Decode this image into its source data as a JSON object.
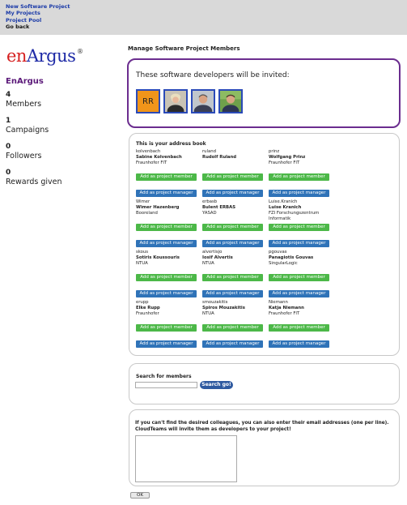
{
  "nav": {
    "new_project": "New Software Project",
    "my_projects": "My Projects",
    "project_pool": "Project Pool",
    "go_back": "Go back"
  },
  "logo": {
    "en": "en",
    "argus": "Argus",
    "reg": "®"
  },
  "sidebar": {
    "app_name": "EnArgus",
    "stats": [
      {
        "num": "4",
        "label": "Members"
      },
      {
        "num": "1",
        "label": "Campaigns"
      },
      {
        "num": "0",
        "label": "Followers"
      },
      {
        "num": "0",
        "label": "Rewards given"
      }
    ]
  },
  "main": {
    "title": "Manage Software Project Members"
  },
  "invite": {
    "text": "These software developers will be invited:",
    "avatars": [
      {
        "type": "initials",
        "text": "RR"
      },
      {
        "type": "photo",
        "icon": "person-photo-woman-icon"
      },
      {
        "type": "photo",
        "icon": "person-photo-man-icon"
      },
      {
        "type": "photo",
        "icon": "person-photo-man-outdoor-icon"
      }
    ]
  },
  "address_book": {
    "title": "This is your address book",
    "add_member_label": "Add as project member",
    "add_manager_label": "Add as project manager",
    "contacts": [
      {
        "user": "kolvenbach",
        "name": "Sabine Kolvenbach",
        "org": "Fraunhofer FIT"
      },
      {
        "user": "ruland",
        "name": "Rudolf Ruland",
        "org": ""
      },
      {
        "user": "prinz",
        "name": "Wolfgang Prinz",
        "org": "Fraunhofer FIT"
      },
      {
        "user": "Wimer",
        "name": "Wimer Hazenberg",
        "org": "Booreland"
      },
      {
        "user": "erbasb",
        "name": "Bulent ERBAS",
        "org": "YASAD"
      },
      {
        "user": "Luise.Kranich",
        "name": "Luise Kranich",
        "org": "FZI Forschungszentrum Informatik"
      },
      {
        "user": "skous",
        "name": "Sotiris Koussouris",
        "org": "NTUA"
      },
      {
        "user": "alvertisjo",
        "name": "Iosif Alvertis",
        "org": "NTUA"
      },
      {
        "user": "pgouvas",
        "name": "Panagiotis Gouvas",
        "org": "SingularLogic"
      },
      {
        "user": "erupp",
        "name": "Elke Rupp",
        "org": "Fraunhofer"
      },
      {
        "user": "smouzakitis",
        "name": "Spiros Mouzakitis",
        "org": "NTUA"
      },
      {
        "user": "Niemann",
        "name": "Katja Niemann",
        "org": "Fraunhofer FIT"
      }
    ]
  },
  "search": {
    "title": "Search for members",
    "button": "Search go!"
  },
  "emails": {
    "text": "If you can't find the desired colleagues, you can also enter their email addresses (one per line). CloudTeams will invite them as developers to your project!"
  },
  "ok_label": "OK"
}
